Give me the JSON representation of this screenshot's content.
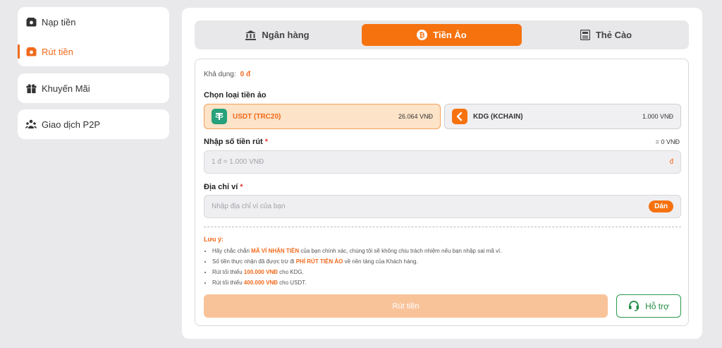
{
  "sidebar": {
    "items": [
      {
        "label": "Nạp tiền",
        "icon": "wallet-icon"
      },
      {
        "label": "Rút tiền",
        "icon": "wallet-out-icon",
        "active": true
      },
      {
        "label": "Khuyến Mãi",
        "icon": "gift-icon"
      },
      {
        "label": "Giao dịch P2P",
        "icon": "users-icon"
      }
    ]
  },
  "tabs": [
    {
      "label": "Ngân hàng",
      "icon": "bank-icon"
    },
    {
      "label": "Tiền Ảo",
      "icon": "bitcoin-icon",
      "active": true
    },
    {
      "label": "Thẻ Cào",
      "icon": "card-icon"
    }
  ],
  "form": {
    "balance_label": "Khả dụng:",
    "balance_value": "0 đ",
    "coin_type_label": "Chọn loại tiền ảo",
    "coins": [
      {
        "name": "USDT (TRC20)",
        "rate": "26.064 VNĐ",
        "icon": "tether-icon",
        "color": "#26a17b",
        "selected": true
      },
      {
        "name": "KDG (KCHAIN)",
        "rate": "1.000 VNĐ",
        "icon": "kdg-icon",
        "color": "#f6720f"
      }
    ],
    "amount_label": "Nhập số tiền rút",
    "required_mark": "*",
    "amount_equivalent": "= 0 VNĐ",
    "amount_placeholder": "1 đ = 1.000 VNĐ",
    "amount_unit": "đ",
    "wallet_label": "Địa chỉ ví",
    "wallet_placeholder": "Nhập địa chỉ ví của bạn",
    "paste_label": "Dán",
    "note_title": "Lưu ý:",
    "notes": [
      {
        "pre": "Hãy chắc chắn ",
        "bold": "MÃ VÍ NHẬN TIỀN",
        "post": " của bạn chính xác, chúng tôi sẽ không chịu trách nhiệm nếu bạn nhập sai mã ví."
      },
      {
        "pre": "Số tiền thực nhận đã được trừ đi ",
        "bold": "PHÍ RÚT TIỀN ẢO",
        "post": " về nền tảng của Khách hàng."
      },
      {
        "pre": "Rút tối thiểu ",
        "bold": "100.000 VNĐ",
        "post": " cho KDG."
      },
      {
        "pre": "Rút tối thiểu ",
        "bold": "400.000 VNĐ",
        "post": " cho USDT."
      }
    ],
    "withdraw_label": "Rút tiền",
    "support_label": "Hỗ trợ"
  },
  "colors": {
    "accent": "#f6720f",
    "support": "#1f8b42"
  }
}
